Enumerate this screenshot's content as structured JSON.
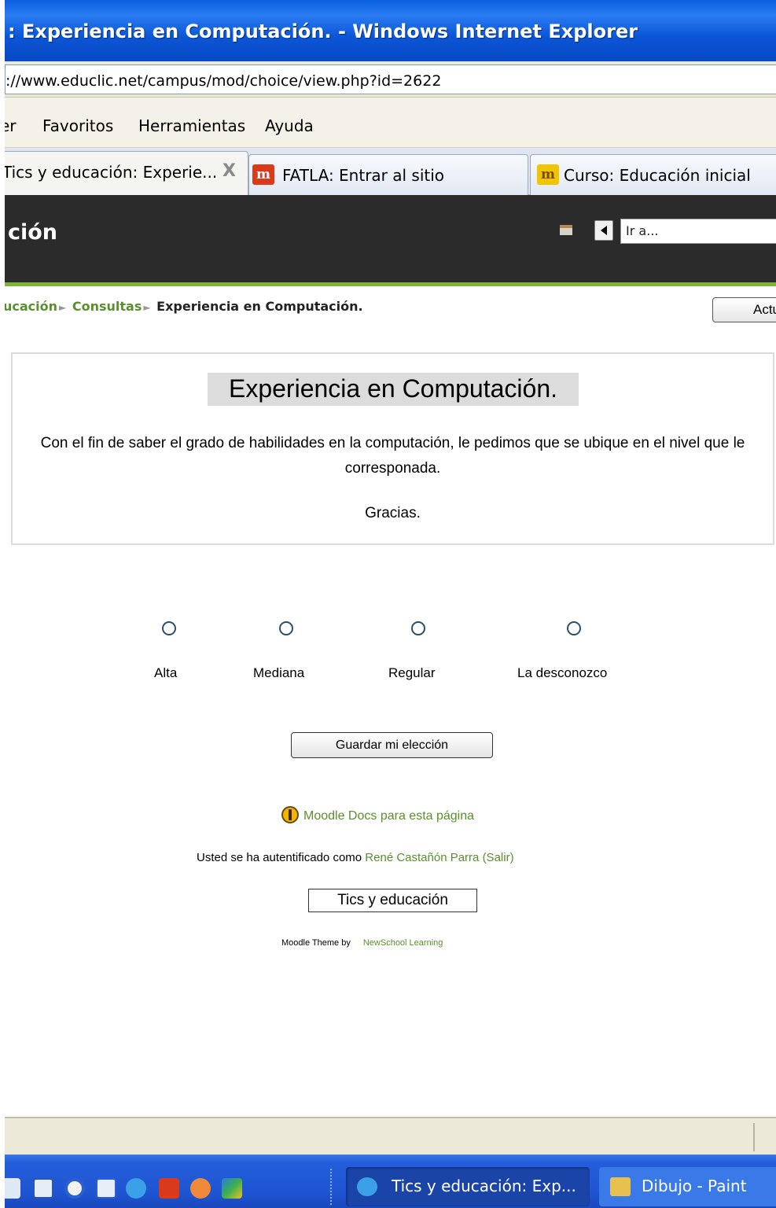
{
  "window": {
    "title": ": Experiencia en Computación. - Windows Internet Explorer",
    "address": "://www.educlic.net/campus/mod/choice/view.php?id=2622"
  },
  "menu": {
    "items": [
      "er",
      "Favoritos",
      "Herramientas",
      "Ayuda"
    ]
  },
  "tabs": [
    {
      "label": "Tics y educación: Experie...",
      "close": "X",
      "active": true
    },
    {
      "label": "FATLA: Entrar al sitio",
      "icon": "moodle-red-icon",
      "icon_text": "m"
    },
    {
      "label": "Curso: Educación inicial",
      "icon": "moodle-gold-icon",
      "icon_text": "m"
    }
  ],
  "site": {
    "name": "ción",
    "jump_placeholder": "Ir a..."
  },
  "breadcrumb": {
    "items": [
      "ucación",
      "Consultas"
    ],
    "current": "Experiencia en Computación.",
    "separator": "►"
  },
  "update_button": "Actu",
  "intro": {
    "heading": "Experiencia en Computación.",
    "description": "Con el fin de saber el grado de habilidades en la computación, le pedimos que se ubique en el nivel que le corresponada.",
    "thanks": "Gracias."
  },
  "options": [
    "Alta",
    "Mediana",
    "Regular",
    "La desconozco"
  ],
  "save_button": "Guardar mi elección",
  "docs_link": "Moodle Docs para esta página",
  "login": {
    "prefix": "Usted se ha autentificado como",
    "user": "René Castañón Parra",
    "logout": "(Salir)"
  },
  "home_button": "Tics y educación",
  "theme": {
    "prefix": "Moodle Theme by",
    "author": "NewSchool Learning"
  },
  "taskbar": {
    "buttons": [
      "Tics y educación: Exp...",
      "Dibujo - Paint"
    ]
  },
  "colors": {
    "link_green": "#5a8f2d",
    "header_dark": "#2b2b2b",
    "xp_blue": "#245edb"
  }
}
